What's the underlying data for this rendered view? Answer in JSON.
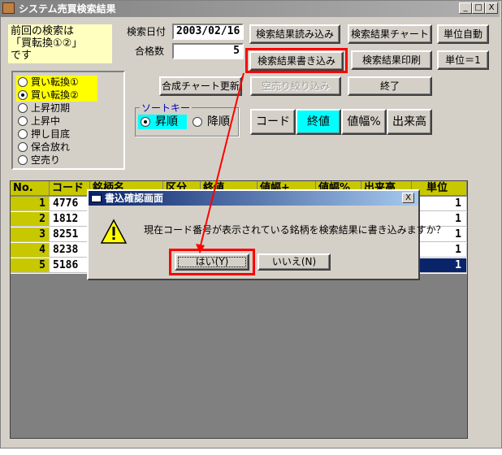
{
  "window": {
    "title": "システム売買検索結果",
    "buttons": [
      "_",
      "□",
      "X"
    ]
  },
  "note": {
    "line1": "前回の検索は",
    "line2": "「買転換①②」",
    "line3": "です"
  },
  "search_date": {
    "label": "検索日付",
    "value": "2003/02/16"
  },
  "pass_count": {
    "label": "合格数",
    "value": "5"
  },
  "buttons": {
    "load": "検索結果読み込み",
    "chart": "検索結果チャート",
    "unit_auto": "単位自動",
    "write": "検索結果書き込み",
    "print": "検索結果印刷",
    "unit_one": "単位＝1",
    "synth": "合成チャート更新",
    "shortsell": "空売り絞り込み",
    "end": "終了"
  },
  "radio_items": [
    {
      "label": "買い転換①",
      "selected": false,
      "highlighted": true
    },
    {
      "label": "買い転換②",
      "selected": true,
      "highlighted": true
    },
    {
      "label": "上昇初期",
      "selected": false,
      "highlighted": false
    },
    {
      "label": "上昇中",
      "selected": false,
      "highlighted": false
    },
    {
      "label": "押し目底",
      "selected": false,
      "highlighted": false
    },
    {
      "label": "保合放れ",
      "selected": false,
      "highlighted": false
    },
    {
      "label": "空売り",
      "selected": false,
      "highlighted": false
    }
  ],
  "sort": {
    "title": "ソートキー",
    "asc": "昇順",
    "desc": "降順",
    "keys": [
      "コード",
      "終値",
      "値幅%",
      "出来高"
    ],
    "active_key": "終値"
  },
  "table": {
    "headers": [
      "No.",
      "コード",
      "銘柄名",
      "区分",
      "終値",
      "値幅+",
      "値幅%",
      "出来高",
      "単位"
    ],
    "rows": [
      {
        "no": "1",
        "code": "4776",
        "unit": "1"
      },
      {
        "no": "2",
        "code": "1812",
        "unit": "1"
      },
      {
        "no": "3",
        "code": "8251",
        "unit": "1"
      },
      {
        "no": "4",
        "code": "8238",
        "unit": "1"
      },
      {
        "no": "5",
        "code": "5186",
        "unit": "1"
      }
    ]
  },
  "dialog": {
    "title": "書込確認画面",
    "message": "現在コード番号が表示されている銘柄を検索結果に書き込みますか？",
    "yes": "はい(Y)",
    "no": "いいえ(N)",
    "close": "X"
  },
  "colors": {
    "highlight_red": "#ff0000",
    "cyan": "#00ffff",
    "header_yellow": "#c8c800"
  }
}
